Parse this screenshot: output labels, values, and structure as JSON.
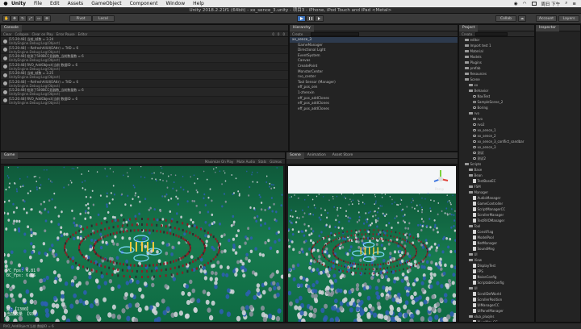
{
  "menubar": {
    "app": "Unity",
    "items": [
      "File",
      "Edit",
      "Assets",
      "GameObject",
      "Component",
      "Window",
      "Help"
    ],
    "clock": "周日 下午"
  },
  "window_title": "Unity 2018.2.21f1 (64bit) - xx_sence_3.unity - 项目3 - iPhone, iPod Touch and iPad <Metal>",
  "toolbar": {
    "pivot": "Pivot",
    "local": "Local",
    "collab": "Collab",
    "account": "Account",
    "layers": "Layers",
    "layout": "Layout"
  },
  "console": {
    "tab": "Console",
    "buttons": [
      "Clear",
      "Collapse",
      "Clear on Play",
      "Error Pause",
      "Editor"
    ],
    "counts": [
      "0",
      "0",
      "0"
    ],
    "rows": [
      {
        "line1": "[15:20:48] 当前_帧数 = 3.24",
        "line2": "UnityEngine.Debug:Log(Object)"
      },
      {
        "line1": "[15:20:48] ---RefreshAllUI(EAttr) = TrID = 6",
        "line2": "UnityEngine.Debug:Log(Object)"
      },
      {
        "line1": "[15:20:48] 检测了500BCC显器数_当前数量数 = 6",
        "line2": "UnityEngine.Debug:Log(Object)"
      },
      {
        "line1": "[15:20:48] RVO_AddObject(当前 数据ID = 6",
        "line2": "UnityEngine.Debug:Log(Object)"
      },
      {
        "line1": "[15:20:48] 当前_帧数 = 3.25",
        "line2": "UnityEngine.Debug:Log(Object)"
      },
      {
        "line1": "[15:20:48] ---RefreshAllUI(EAttr) = TrID = 6",
        "line2": "UnityEngine.Debug:Log(Object)"
      },
      {
        "line1": "[15:20:48] 检测了500BCC显器数_当前数量数 = 6",
        "line2": "UnityEngine.Debug:Log(Object)"
      },
      {
        "line1": "[15:20:48] RVO_AddObject(当前 数据ID = 6",
        "line2": "UnityEngine.Debug:Log(Object)"
      }
    ]
  },
  "hierarchy": {
    "tab": "Hierarchy",
    "create": "Create",
    "root": "xx_sence_3",
    "items": [
      "GameManager",
      "Directional Light",
      "EventSystem",
      "Canvas",
      "CreatePoint",
      "MonsterCenter",
      "rvo_center",
      "Tool Sensor (Manager)",
      "eff_pos_sen",
      "1-zhenxin",
      "eff_pos_addClones",
      "eff_pos_addClones",
      "eff_pos_addClones"
    ]
  },
  "project": {
    "tab": "Project",
    "create": "Create",
    "items": [
      {
        "label": "editor",
        "kind": "folder",
        "indent": 1
      },
      {
        "label": "Import test 1",
        "kind": "folder",
        "indent": 1
      },
      {
        "label": "Material",
        "kind": "folder",
        "indent": 1
      },
      {
        "label": "Models",
        "kind": "folder",
        "indent": 1
      },
      {
        "label": "Plugins",
        "kind": "folder",
        "indent": 1
      },
      {
        "label": "prefab",
        "kind": "folder",
        "indent": 1
      },
      {
        "label": "Resources",
        "kind": "folder",
        "indent": 1
      },
      {
        "label": "Scene",
        "kind": "folder",
        "indent": 1
      },
      {
        "label": "xx",
        "kind": "folder",
        "indent": 2
      },
      {
        "label": "Behavior",
        "kind": "folder",
        "indent": 2
      },
      {
        "label": "NavTest",
        "kind": "scene",
        "indent": 3
      },
      {
        "label": "SampleScene_2",
        "kind": "scene",
        "indent": 3
      },
      {
        "label": "Boring",
        "kind": "scene",
        "indent": 3
      },
      {
        "label": "rvo",
        "kind": "folder",
        "indent": 2
      },
      {
        "label": "rvo",
        "kind": "scene",
        "indent": 3
      },
      {
        "label": "rvo2",
        "kind": "scene",
        "indent": 3
      },
      {
        "label": "xx_sence_1",
        "kind": "scene",
        "indent": 3
      },
      {
        "label": "xx_sence_2",
        "kind": "scene",
        "indent": 3
      },
      {
        "label": "xx_sence_3_conflict_sandbar",
        "kind": "scene",
        "indent": 3
      },
      {
        "label": "xx_sence_3",
        "kind": "scene",
        "indent": 3
      },
      {
        "label": "测试",
        "kind": "scene",
        "indent": 3
      },
      {
        "label": "测试2",
        "kind": "scene",
        "indent": 3
      },
      {
        "label": "Scripts",
        "kind": "folder",
        "indent": 1
      },
      {
        "label": "Base",
        "kind": "folder",
        "indent": 2
      },
      {
        "label": "Bean",
        "kind": "folder",
        "indent": 2
      },
      {
        "label": "TestBaseEC",
        "kind": "file",
        "indent": 3
      },
      {
        "label": "FSM",
        "kind": "folder",
        "indent": 2
      },
      {
        "label": "Manager",
        "kind": "folder",
        "indent": 2
      },
      {
        "label": "AudioManager",
        "kind": "file",
        "indent": 3
      },
      {
        "label": "GameController",
        "kind": "file",
        "indent": 3
      },
      {
        "label": "ScriptManagerCC",
        "kind": "file",
        "indent": 3
      },
      {
        "label": "ScrollerManager",
        "kind": "file",
        "indent": 3
      },
      {
        "label": "TestRVOManager",
        "kind": "file",
        "indent": 3
      },
      {
        "label": "Tool",
        "kind": "folder",
        "indent": 2
      },
      {
        "label": "ConstFlag",
        "kind": "file",
        "indent": 3
      },
      {
        "label": "ModelPool",
        "kind": "file",
        "indent": 3
      },
      {
        "label": "NetManager",
        "kind": "file",
        "indent": 3
      },
      {
        "label": "SoundMng",
        "kind": "file",
        "indent": 3
      },
      {
        "label": "UI",
        "kind": "folder",
        "indent": 2
      },
      {
        "label": "View",
        "kind": "folder",
        "indent": 2
      },
      {
        "label": "DisplayTest",
        "kind": "file",
        "indent": 3
      },
      {
        "label": "FPS",
        "kind": "file",
        "indent": 3
      },
      {
        "label": "NoiseConfig",
        "kind": "file",
        "indent": 3
      },
      {
        "label": "ScriptableConfig",
        "kind": "file",
        "indent": 3
      },
      {
        "label": "UI",
        "kind": "folder",
        "indent": 2
      },
      {
        "label": "ScrollDefWorld",
        "kind": "file",
        "indent": 3
      },
      {
        "label": "ScrollerPosition",
        "kind": "file",
        "indent": 3
      },
      {
        "label": "UIManagerCC",
        "kind": "file",
        "indent": 3
      },
      {
        "label": "UIPanelManager",
        "kind": "file",
        "indent": 3
      },
      {
        "label": "xlua_pluqins",
        "kind": "folder",
        "indent": 2
      },
      {
        "label": "XLuaMgr_CC",
        "kind": "file",
        "indent": 3
      },
      {
        "label": "XLSettingSCreateCC",
        "kind": "file",
        "indent": 3
      },
      {
        "label": "XLProject CC",
        "kind": "file",
        "indent": 3
      },
      {
        "label": "Editor",
        "kind": "file",
        "indent": 3
      }
    ]
  },
  "inspector": {
    "tab": "Inspector"
  },
  "game_view": {
    "tab": "Game",
    "controls": [
      "Maximize On Play",
      "Mute Audio",
      "Stats",
      "Gizmos"
    ],
    "fps_line1": "PC_Fps: 6.81",
    "fps_line2": "BC_Fps: 6.66",
    "count_line1": "总:【1300】",
    "count_line2": "当前数量 【93】"
  },
  "scene_view": {
    "tabs": [
      "Scene",
      "Animation",
      "Asset Store"
    ],
    "gizmo_label": "Persp"
  },
  "status": "RVO_AddObject(当前 数据ID = 6"
}
